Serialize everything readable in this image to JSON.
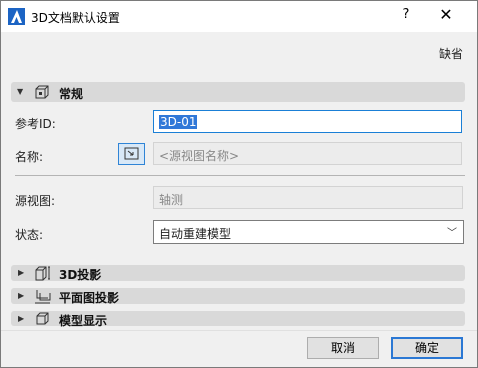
{
  "window": {
    "title": "3D文档默认设置",
    "help_label": "?",
    "close_label": "✕"
  },
  "default_label": "缺省",
  "sections": {
    "general": {
      "title": "常规",
      "expanded": true
    },
    "projection3d": {
      "title": "3D投影",
      "expanded": false
    },
    "floorplan": {
      "title": "平面图投影",
      "expanded": false
    },
    "model_display": {
      "title": "模型显示",
      "expanded": false
    }
  },
  "fields": {
    "ref_id": {
      "label": "参考ID:",
      "value": "3D-01"
    },
    "name": {
      "label": "名称:",
      "placeholder": "<源视图名称>"
    },
    "source_view": {
      "label": "源视图:",
      "value": "轴测"
    },
    "status": {
      "label": "状态:",
      "value": "自动重建模型"
    }
  },
  "buttons": {
    "cancel": "取消",
    "ok": "确定"
  },
  "colors": {
    "accent": "#2b78d4",
    "section_bg": "#d9d9d9",
    "selection": "#3078d8"
  }
}
